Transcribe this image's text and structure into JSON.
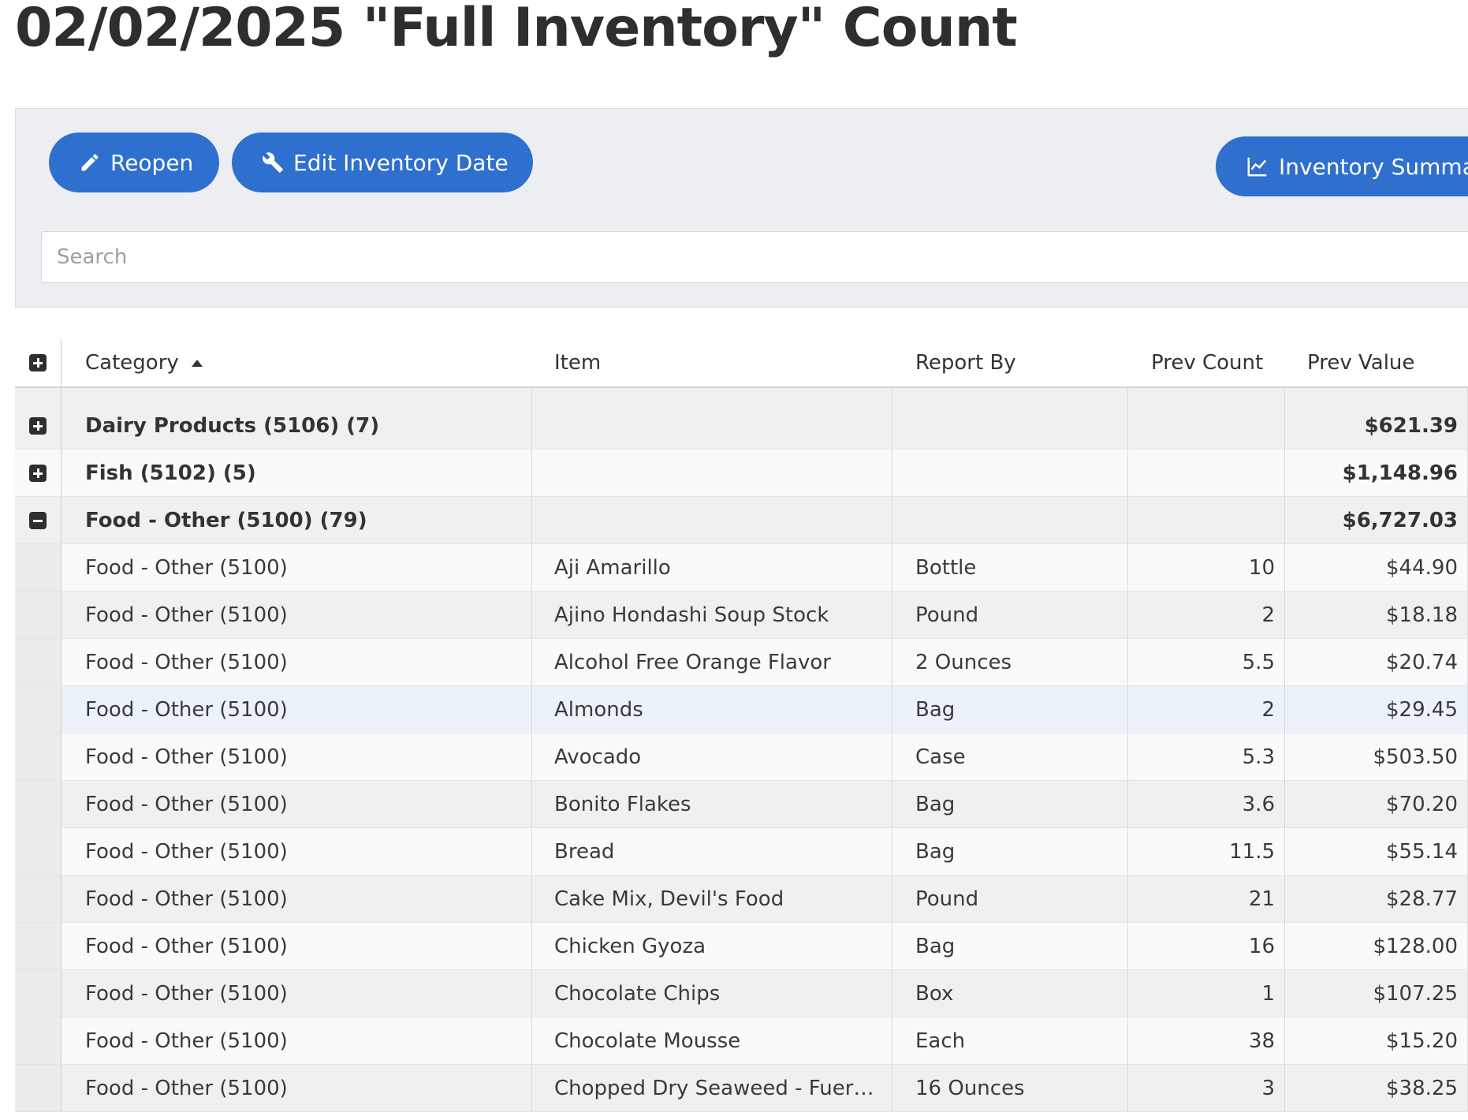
{
  "page": {
    "title": "02/02/2025 \"Full Inventory\" Count"
  },
  "toolbar": {
    "reopen_label": "Reopen",
    "edit_date_label": "Edit Inventory Date",
    "summary_label": "Inventory Summary",
    "reopen_icon": "pencil-icon",
    "edit_date_icon": "wrench-icon",
    "summary_icon": "line-chart-icon",
    "button_color": "#2f6fcd"
  },
  "search": {
    "placeholder": "Search",
    "value": ""
  },
  "grid": {
    "columns": {
      "category": "Category",
      "item": "Item",
      "report_by": "Report By",
      "prev_count": "Prev Count",
      "prev_value": "Prev Value"
    },
    "sort": {
      "column": "Category",
      "direction": "ascending"
    },
    "groups": [
      {
        "label": "Dairy Products (5106) (7)",
        "prev_value": "$621.39",
        "expanded": false
      },
      {
        "label": "Fish (5102) (5)",
        "prev_value": "$1,148.96",
        "expanded": false
      },
      {
        "label": "Food - Other (5100) (79)",
        "prev_value": "$6,727.03",
        "expanded": true
      }
    ],
    "rows": [
      {
        "category": "Food - Other (5100)",
        "item": "Aji Amarillo",
        "report_by": "Bottle",
        "prev_count": "10",
        "prev_value": "$44.90"
      },
      {
        "category": "Food - Other (5100)",
        "item": "Ajino Hondashi Soup Stock",
        "report_by": "Pound",
        "prev_count": "2",
        "prev_value": "$18.18"
      },
      {
        "category": "Food - Other (5100)",
        "item": "Alcohol Free Orange Flavor",
        "report_by": "2 Ounces",
        "prev_count": "5.5",
        "prev_value": "$20.74"
      },
      {
        "category": "Food - Other (5100)",
        "item": "Almonds",
        "report_by": "Bag",
        "prev_count": "2",
        "prev_value": "$29.45"
      },
      {
        "category": "Food - Other (5100)",
        "item": "Avocado",
        "report_by": "Case",
        "prev_count": "5.3",
        "prev_value": "$503.50"
      },
      {
        "category": "Food - Other (5100)",
        "item": "Bonito Flakes",
        "report_by": "Bag",
        "prev_count": "3.6",
        "prev_value": "$70.20"
      },
      {
        "category": "Food - Other (5100)",
        "item": "Bread",
        "report_by": "Bag",
        "prev_count": "11.5",
        "prev_value": "$55.14"
      },
      {
        "category": "Food - Other (5100)",
        "item": "Cake Mix, Devil's Food",
        "report_by": "Pound",
        "prev_count": "21",
        "prev_value": "$28.77"
      },
      {
        "category": "Food - Other (5100)",
        "item": "Chicken Gyoza",
        "report_by": "Bag",
        "prev_count": "16",
        "prev_value": "$128.00"
      },
      {
        "category": "Food - Other (5100)",
        "item": "Chocolate Chips",
        "report_by": "Box",
        "prev_count": "1",
        "prev_value": "$107.25"
      },
      {
        "category": "Food - Other (5100)",
        "item": "Chocolate Mousse",
        "report_by": "Each",
        "prev_count": "38",
        "prev_value": "$15.20"
      },
      {
        "category": "Food - Other (5100)",
        "item": "Chopped Dry Seaweed - Fueru wa…",
        "report_by": "16 Ounces",
        "prev_count": "3",
        "prev_value": "$38.25"
      }
    ]
  }
}
